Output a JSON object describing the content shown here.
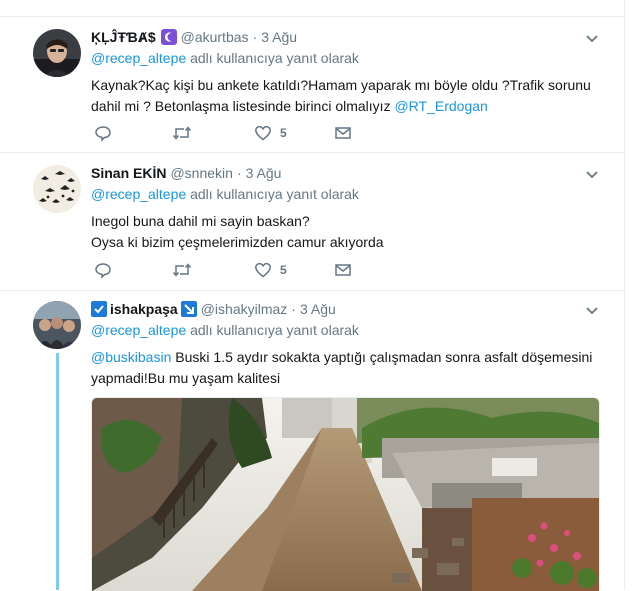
{
  "tweets": [
    {
      "name": "ĶĻĴŦƁȺ$",
      "handle": "@akurtbas",
      "date": "3 Ağu",
      "reply_prefix": "@recep_altepe",
      "reply_suffix": "adlı kullanıcıya yanıt olarak",
      "text_line1": "Kaynak?Kaç kişi bu ankete katıldı?Hamam yaparak mı böyle oldu ?Trafik sorunu",
      "text_line2": "dahil mi ? Betonlaşma listesinde birinci olmalıyız",
      "text_link": "@RT_Erdogan",
      "like_count": "5",
      "badge_color": "#7b4fd6"
    },
    {
      "name": "Sinan EKİN",
      "handle": "@snnekin",
      "date": "3 Ağu",
      "reply_prefix": "@recep_altepe",
      "reply_suffix": "adlı kullanıcıya yanıt olarak",
      "text_line1": "Inegol buna dahil mi sayin baskan?",
      "text_line2": "Oysa ki bizim çeşmelerimizden camur akıyorda",
      "like_count": "5"
    },
    {
      "name": "ishakpaşa",
      "handle": "@ishakyilmaz",
      "date": "3 Ağu",
      "reply_prefix": "@recep_altepe",
      "reply_suffix": "adlı kullanıcıya yanıt olarak",
      "text_mention": "@buskibasin",
      "text_line1": "Buski 1.5 aydır sokakta yaptığı çalışmadan sonra asfalt döşemesini",
      "text_line2": "yapmadi!Bu mu yaşam kalitesi",
      "badge_color": "#1d7bd8"
    }
  ],
  "icons": {
    "reply": "reply-icon",
    "retweet": "retweet-icon",
    "like": "heart-icon",
    "dm": "envelope-icon",
    "caret": "chevron-down-icon"
  },
  "colors": {
    "link": "#1b95e0",
    "muted": "#657786",
    "thread_line": "#7fcbf1"
  }
}
